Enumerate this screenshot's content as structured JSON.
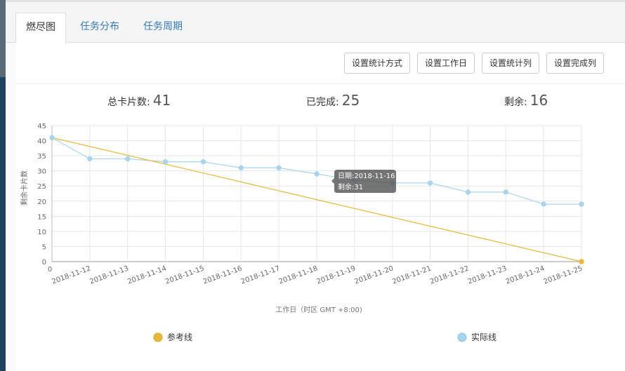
{
  "tabs": [
    {
      "label": "燃尽图",
      "active": true
    },
    {
      "label": "任务分布",
      "active": false
    },
    {
      "label": "任务周期",
      "active": false
    }
  ],
  "toolbar": {
    "buttons": [
      "设置统计方式",
      "设置工作日",
      "设置统计列",
      "设置完成列"
    ]
  },
  "stats": {
    "total_label": "总卡片数:",
    "total": "41",
    "done_label": "已完成:",
    "done": "25",
    "remaining_label": "剩余:",
    "remaining": "16"
  },
  "tooltip": {
    "date_line": "日期:2018-11-16",
    "remain_line": "剩余:31"
  },
  "chart_data": {
    "type": "line",
    "xlabel": "工作日（时区 GMT +8:00)",
    "ylabel": "剩余卡片数",
    "x": [
      "0",
      "2018-11-12",
      "2018-11-13",
      "2018-11-14",
      "2018-11-15",
      "2018-11-16",
      "2018-11-17",
      "2018-11-18",
      "2018-11-19",
      "2018-11-20",
      "2018-11-21",
      "2018-11-22",
      "2018-11-23",
      "2018-11-24",
      "2018-11-25"
    ],
    "ylim": [
      0,
      45
    ],
    "yticks": [
      0,
      5,
      10,
      15,
      20,
      25,
      30,
      35,
      40,
      45
    ],
    "grid": true,
    "legend_position": "bottom",
    "series": [
      {
        "name": "参考线",
        "color": "#e8b83a",
        "values": [
          41,
          null,
          null,
          null,
          null,
          null,
          null,
          null,
          null,
          null,
          null,
          null,
          null,
          null,
          0
        ]
      },
      {
        "name": "实际线",
        "color": "#a9d4ee",
        "values": [
          41,
          34,
          34,
          33,
          33,
          31,
          31,
          29,
          27,
          26,
          26,
          23,
          23,
          19,
          19
        ]
      }
    ]
  }
}
